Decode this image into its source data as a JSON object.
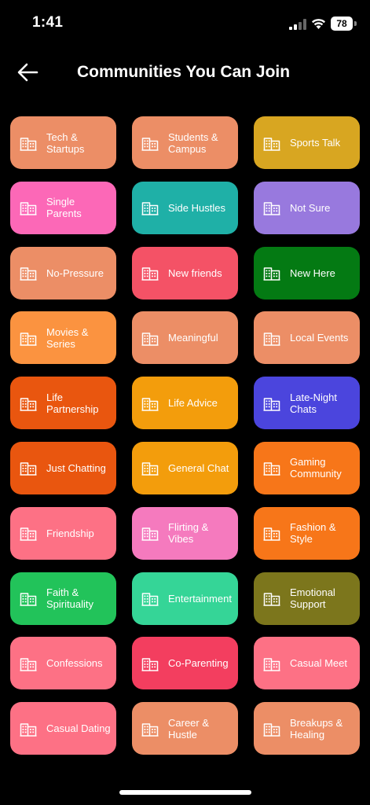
{
  "status_bar": {
    "time": "1:41",
    "battery_level": "78"
  },
  "header": {
    "title": "Communities You Can Join"
  },
  "icons": {
    "back": "arrow-left-icon",
    "tile": "building-icon"
  },
  "communities": [
    {
      "label": "Tech & Startups",
      "color": "#EC8E66"
    },
    {
      "label": "Students & Campus",
      "color": "#EC8E66"
    },
    {
      "label": "Sports Talk",
      "color": "#D8A621"
    },
    {
      "label": "Single Parents",
      "color": "#FC68B7"
    },
    {
      "label": "Side Hustles",
      "color": "#1FB0A7"
    },
    {
      "label": "Not Sure",
      "color": "#9879DE"
    },
    {
      "label": "No-Pressure",
      "color": "#EC8E66"
    },
    {
      "label": "New friends",
      "color": "#F45266"
    },
    {
      "label": "New Here",
      "color": "#047A13"
    },
    {
      "label": "Movies & Series",
      "color": "#FB9340"
    },
    {
      "label": "Meaningful",
      "color": "#EC8E66"
    },
    {
      "label": "Local Events",
      "color": "#EC8E66"
    },
    {
      "label": "Life Partnership",
      "color": "#E9560F"
    },
    {
      "label": "Life Advice",
      "color": "#F39D0C"
    },
    {
      "label": "Late-Night Chats",
      "color": "#4B45DD"
    },
    {
      "label": "Just Chatting",
      "color": "#E9560F"
    },
    {
      "label": "General Chat",
      "color": "#F39D0C"
    },
    {
      "label": "Gaming Community",
      "color": "#F77619"
    },
    {
      "label": "Friendship",
      "color": "#FD7185"
    },
    {
      "label": "Flirting & Vibes",
      "color": "#F57ABE"
    },
    {
      "label": "Fashion & Style",
      "color": "#F77619"
    },
    {
      "label": "Faith & Spirituality",
      "color": "#22C35A"
    },
    {
      "label": "Entertainment",
      "color": "#35D597"
    },
    {
      "label": "Emotional Support",
      "color": "#7C761C"
    },
    {
      "label": "Confessions",
      "color": "#FD7185"
    },
    {
      "label": "Co-Parenting",
      "color": "#F33E5F"
    },
    {
      "label": "Casual Meet",
      "color": "#FD7185"
    },
    {
      "label": "Casual Dating",
      "color": "#FD7185"
    },
    {
      "label": "Career & Hustle",
      "color": "#EC8E66"
    },
    {
      "label": "Breakups & Healing",
      "color": "#EC8E66"
    }
  ]
}
